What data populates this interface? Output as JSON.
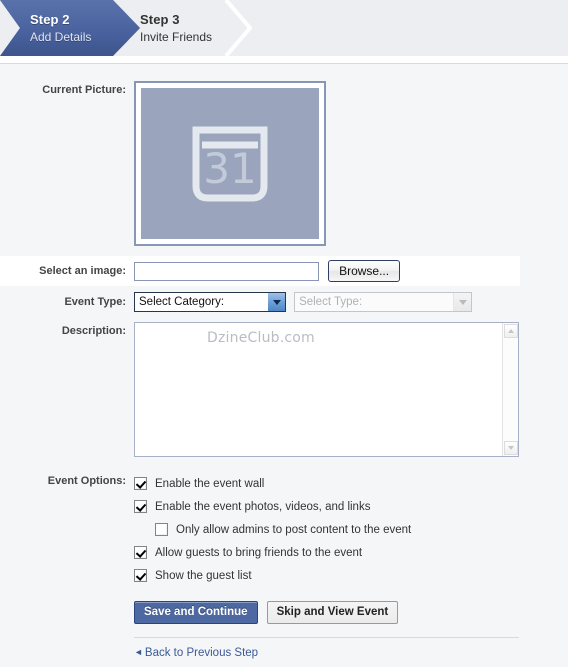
{
  "steps": [
    {
      "title": "Step 2",
      "subtitle": "Add Details",
      "state": "active"
    },
    {
      "title": "Step 3",
      "subtitle": "Invite Friends",
      "state": "upcoming"
    }
  ],
  "form": {
    "current_picture": {
      "label": "Current Picture:",
      "icon": "calendar-icon",
      "icon_day": "31"
    },
    "select_image": {
      "label": "Select an image:",
      "input_value": "",
      "input_placeholder": "",
      "browse_label": "Browse..."
    },
    "event_type": {
      "label": "Event Type:",
      "category_value": "Select Category:",
      "type_value": "Select Type:",
      "type_disabled": true
    },
    "description": {
      "label": "Description:",
      "value": "",
      "watermark": "DzineClub.com"
    },
    "event_options": {
      "label": "Event Options:",
      "items": [
        {
          "label": "Enable the event wall",
          "checked": true,
          "indented": false
        },
        {
          "label": "Enable the event photos, videos, and links",
          "checked": true,
          "indented": false
        },
        {
          "label": "Only allow admins to post content to the event",
          "checked": false,
          "indented": true
        },
        {
          "label": "Allow guests to bring friends to the event",
          "checked": true,
          "indented": false
        },
        {
          "label": "Show the guest list",
          "checked": true,
          "indented": false
        }
      ]
    },
    "actions": {
      "primary_label": "Save and Continue",
      "secondary_label": "Skip and View Event",
      "back_link": "Back to Previous Step",
      "back_arrow": "◄"
    }
  },
  "colors": {
    "accent": "#4a639f",
    "link": "#3b5998",
    "stepbar_bg": "#eceef1",
    "page_bg": "#f5f6f7",
    "picture_fill": "#9aa5bd",
    "picture_border": "#8a96b5"
  }
}
